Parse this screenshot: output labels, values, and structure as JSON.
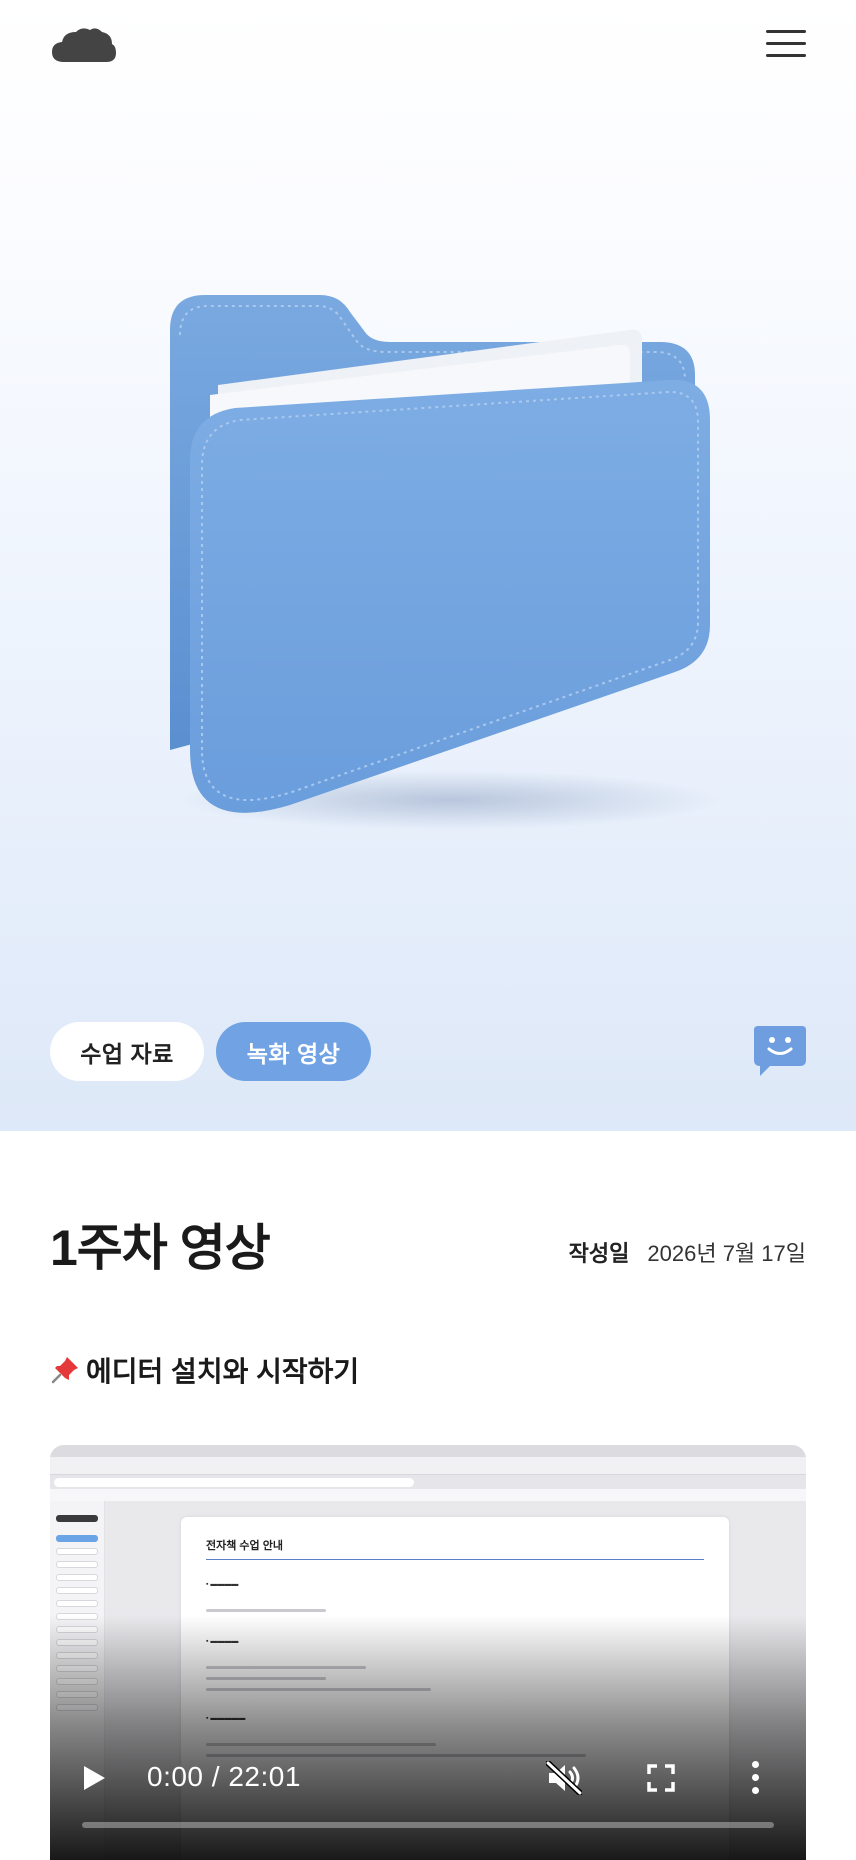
{
  "header": {
    "logo_icon": "cloud-icon",
    "menu_icon": "hamburger-menu-icon"
  },
  "hero": {
    "image": "blue-felt-folder-illustration",
    "tabs": [
      {
        "label": "수업 자료",
        "active": false
      },
      {
        "label": "녹화 영상",
        "active": true
      }
    ],
    "chat_icon": "smile-chat-bubble-icon",
    "accent_color": "#70a2e4"
  },
  "post": {
    "title": "1주차 영상",
    "date_label": "작성일",
    "date_value": "2026년 7월 17일"
  },
  "section": {
    "emoji": "📌",
    "title": "에디터 설치와 시작하기"
  },
  "video": {
    "current_time": "0:00",
    "separator": " / ",
    "duration": "22:01",
    "progress": 0,
    "muted": true,
    "screen": {
      "doc_title": "전자책 수업 안내"
    }
  }
}
